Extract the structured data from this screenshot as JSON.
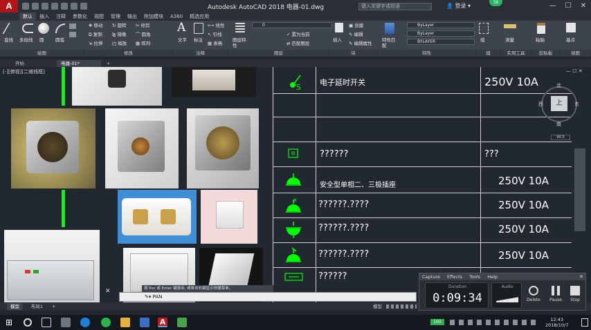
{
  "titlebar": {
    "title": "Autodesk AutoCAD 2018    电器-01.dwg",
    "logo": "A",
    "search_placeholder": "键入关键字或短语",
    "login": "登录",
    "badge": "36"
  },
  "ribbon_tabs": [
    "默认",
    "插入",
    "注释",
    "参数化",
    "视图",
    "管理",
    "输出",
    "附加模块",
    "A360",
    "精选应用"
  ],
  "ribbon": {
    "groups": [
      "绘图",
      "修改",
      "注释",
      "图层",
      "块",
      "特性",
      "组",
      "实用工具",
      "剪贴板",
      "视图"
    ],
    "draw_tools": [
      "直线",
      "多段线",
      "圆",
      "圆弧"
    ],
    "modify_tools": [
      "移动",
      "旋转",
      "修剪",
      "复制",
      "镜像",
      "圆角",
      "拉伸",
      "缩放",
      "阵列"
    ],
    "annotation_tools": [
      "文字",
      "标注",
      "线性",
      "引线",
      "表格"
    ],
    "layer_label": "图层特性",
    "layer_combo": "0",
    "block_tools": [
      "插入",
      "创建",
      "编辑",
      "编辑属性"
    ],
    "layer_tools": [
      "置为当前",
      "匹配图层"
    ],
    "properties_label": "特性匹配",
    "bylayer_1": "ByLayer",
    "bylayer_2": "ByLayer",
    "bylayer_3": "BYLAYER",
    "group_label": "组",
    "measure_label": "测量",
    "paste_label": "粘贴",
    "base_label": "基点"
  },
  "doc_tabs": [
    "开始",
    "电器-01*"
  ],
  "view_label": "[-][俯视][二维线框]",
  "viewcube": {
    "top": "上",
    "north": "北",
    "south": "南",
    "east": "东",
    "west": "西",
    "wcs": "WCS"
  },
  "table_rows": [
    {
      "desc": "电子延时开关",
      "spec": "250V  10A"
    },
    {
      "desc": "",
      "spec": ""
    },
    {
      "desc": "",
      "spec": ""
    },
    {
      "desc": "??????",
      "spec": "???"
    },
    {
      "desc": "安全型单相二、三极插座",
      "spec": "250V  10A"
    },
    {
      "desc": "??????.????",
      "spec": "250V  10A"
    },
    {
      "desc": "??????.????",
      "spec": "250V  10A"
    },
    {
      "desc": "??????.????",
      "spec": "250V  10A"
    },
    {
      "desc": "??????",
      "spec": ""
    }
  ],
  "command": {
    "tip": "按 Esc 或 Enter 键退出, 或单击右键显示快捷菜单。",
    "text": "PAN"
  },
  "status": {
    "tabs": [
      "模型",
      "布局1"
    ],
    "model_label": "模型"
  },
  "recorder": {
    "menu": [
      "Capture",
      "Effects",
      "Tools",
      "Help"
    ],
    "duration_label": "Duration",
    "duration": "0:09:34",
    "audio_label": "Audio",
    "buttons": [
      "Delete",
      "Pause",
      "Stop"
    ]
  },
  "taskbar": {
    "time": "12:43",
    "date": "2018/10/7",
    "battery": "100"
  },
  "colors": {
    "app_red": "#b3141a",
    "cad_green": "#00ff00",
    "bg": "#212830"
  }
}
